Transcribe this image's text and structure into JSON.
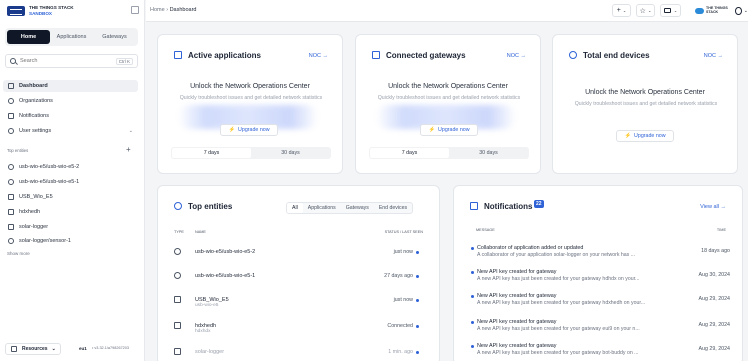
{
  "app": {
    "logo_line1": "THE THINGS STACK",
    "logo_line2": "SANDBOX"
  },
  "top_tabs": [
    "Home",
    "Applications",
    "Gateways"
  ],
  "search": {
    "placeholder": "Search",
    "shortcut": "Ctrl  K"
  },
  "nav": [
    {
      "label": "Dashboard",
      "icon": "grid-icon",
      "active": true
    },
    {
      "label": "Organizations",
      "icon": "users-icon"
    },
    {
      "label": "Notifications",
      "icon": "inbox-icon"
    },
    {
      "label": "User settings",
      "icon": "user-icon"
    }
  ],
  "entities_label": "Top entities",
  "entities": [
    {
      "label": "usb-wio-e5/usb-wio-e5-2",
      "icon": "device-icon"
    },
    {
      "label": "usb-wio-e5/usb-wio-e5-1",
      "icon": "device-icon"
    },
    {
      "label": "USB_Wio_E5",
      "icon": "gateway-icon"
    },
    {
      "label": "hdxhedh",
      "icon": "gateway-icon"
    },
    {
      "label": "solar-logger",
      "icon": "application-icon"
    },
    {
      "label": "solar-logger/sensor-1",
      "icon": "device-icon"
    }
  ],
  "show_more": "Show more",
  "footer": {
    "resources": "Resources",
    "cluster": "eu1",
    "version": "• v3.32.1/a798267203"
  },
  "breadcrumb": {
    "root": "Home",
    "current": "Dashboard"
  },
  "topbar": {
    "add": "+",
    "star": "☆",
    "user_name": "THE THINGS STACK"
  },
  "cards": {
    "applications": {
      "title": "Active applications",
      "noc": "NOC →"
    },
    "gateways": {
      "title": "Connected gateways",
      "noc": "NOC →"
    },
    "devices": {
      "title": "Total end devices",
      "noc": "NOC →"
    },
    "unlock_title": "Unlock the Network Operations Center",
    "unlock_sub": "Quickly troubleshoot issues and get detailed network statistics",
    "upgrade": "Upgrade now",
    "periods": [
      "7 days",
      "30 days"
    ]
  },
  "top_entities": {
    "title": "Top entities",
    "tabs": [
      "All",
      "Applications",
      "Gateways",
      "End devices"
    ],
    "col_type": "TYPE",
    "col_name": "NAME",
    "col_status": "STATUS / LAST SEEN",
    "rows": [
      {
        "name": "usb-wio-e5/usb-wio-e5-2",
        "sub": "",
        "status": "just now",
        "icon": "device-icon"
      },
      {
        "name": "usb-wio-e5/usb-wio-e5-1",
        "sub": "",
        "status": "27 days ago",
        "icon": "device-icon"
      },
      {
        "name": "USB_Wio_E5",
        "sub": "usb-wio-e5",
        "status": "just now",
        "icon": "application-icon"
      },
      {
        "name": "hdxhedh",
        "sub": "hdxhdx",
        "status": "Connected",
        "icon": "gateway-icon"
      },
      {
        "name": "solar-logger",
        "sub": "",
        "status": "1 min. ago",
        "icon": "application-icon"
      }
    ]
  },
  "notifications": {
    "title": "Notifications",
    "count": "22",
    "view_all": "View all →",
    "col_message": "MESSAGE",
    "col_time": "TIME",
    "items": [
      {
        "title": "Collaborator of application added or updated",
        "desc": "A collaborator of your application solar-logger on your network has ...",
        "time": "18 days ago"
      },
      {
        "title": "New API key created for gateway",
        "desc": "A new API key has just been created for your gateway hdhdx on your...",
        "time": "Aug 30, 2024"
      },
      {
        "title": "New API key created for gateway",
        "desc": "A new API key has just been created for your gateway hdxhedh on your...",
        "time": "Aug 29, 2024"
      },
      {
        "title": "New API key created for gateway",
        "desc": "A new API key has just been created for your gateway eui9 on your n...",
        "time": "Aug 29, 2024"
      },
      {
        "title": "New API key created for gateway",
        "desc": "A new API key has just been created for your gateway bot-buddy on ...",
        "time": "Aug 29, 2024"
      }
    ]
  },
  "colors": {
    "accent": "#2e62d6",
    "dark": "#101827"
  }
}
